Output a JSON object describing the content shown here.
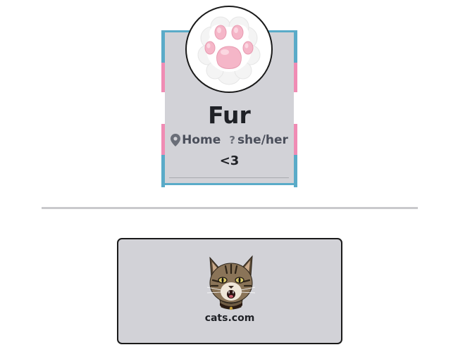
{
  "profile": {
    "name": "Fur",
    "location": "Home",
    "pronouns": "she/her",
    "pronoun_marker": "?",
    "bio": "<3",
    "avatar_icon": "cat-paw-icon",
    "flag_colors": {
      "blue": "#5aabc8",
      "pink": "#f08cb4",
      "white": "#ffffff"
    },
    "card_background": "#d2d2d7"
  },
  "links": [
    {
      "label": "cats.com",
      "icon": "cat-head-icon"
    }
  ]
}
